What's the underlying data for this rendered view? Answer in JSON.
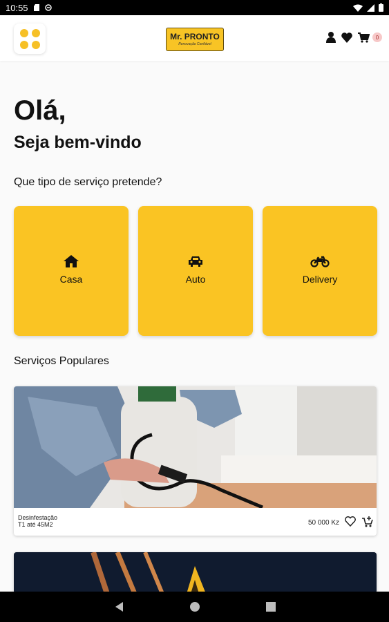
{
  "status_bar": {
    "time": "10:55"
  },
  "header": {
    "logo_text": "Mr. PRONTO",
    "logo_subtitle": "Renovação Confiável",
    "cart_count": "0"
  },
  "greeting": "Olá,",
  "welcome": "Seja bem-vindo",
  "question": "Que tipo de serviço pretende?",
  "categories": [
    {
      "label": "Casa",
      "icon": "home-icon"
    },
    {
      "label": "Auto",
      "icon": "car-icon"
    },
    {
      "label": "Delivery",
      "icon": "motorcycle-icon"
    }
  ],
  "popular": {
    "title": "Serviços Populares",
    "items": [
      {
        "name": "Desinfestação",
        "subtitle": "T1 até 45M2",
        "price": "50 000 Kz",
        "image": "person-spraying-disinfectant"
      },
      {
        "image": "tools-on-dark-background"
      }
    ]
  },
  "colors": {
    "accent": "#fac423",
    "background": "#fafafa",
    "text": "#111111"
  }
}
